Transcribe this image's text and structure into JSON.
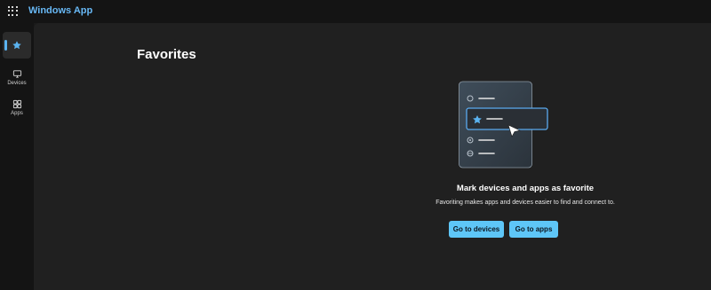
{
  "app": {
    "title": "Windows App"
  },
  "sidebar": {
    "items": [
      {
        "label": "",
        "icon": "star-icon",
        "selected": true
      },
      {
        "label": "Devices",
        "icon": "monitor-icon",
        "selected": false
      },
      {
        "label": "Apps",
        "icon": "apps-grid-icon",
        "selected": false
      }
    ]
  },
  "main": {
    "title": "Favorites",
    "empty_state": {
      "heading": "Mark devices and apps as favorite",
      "description": "Favoriting makes apps and devices easier to find and connect to.",
      "buttons": {
        "devices_label": "Go to devices",
        "apps_label": "Go to apps"
      }
    }
  },
  "colors": {
    "accent": "#68b8f5",
    "button_bg": "#5ec6f7",
    "background": "#202020",
    "sidebar_bg": "#141414"
  }
}
